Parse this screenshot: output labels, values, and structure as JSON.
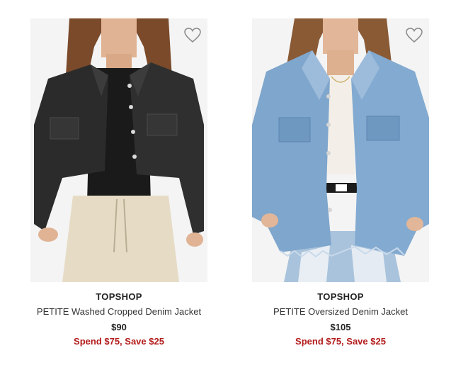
{
  "products": [
    {
      "brand": "TOPSHOP",
      "name": "PETITE Washed Cropped Denim Jacket",
      "price": "$90",
      "promo": "Spend $75, Save $25",
      "image_alt": "Model wearing black cropped denim jacket with beige joggers",
      "favorite_icon": "heart-outline-icon"
    },
    {
      "brand": "TOPSHOP",
      "name": "PETITE Oversized Denim Jacket",
      "price": "$105",
      "promo": "Spend $75, Save $25",
      "image_alt": "Model wearing oversized light blue denim jacket with distressed jeans",
      "favorite_icon": "heart-outline-icon"
    }
  ],
  "colors": {
    "promo": "#b31b1b",
    "text": "#222222",
    "heart_stroke": "#888888"
  }
}
